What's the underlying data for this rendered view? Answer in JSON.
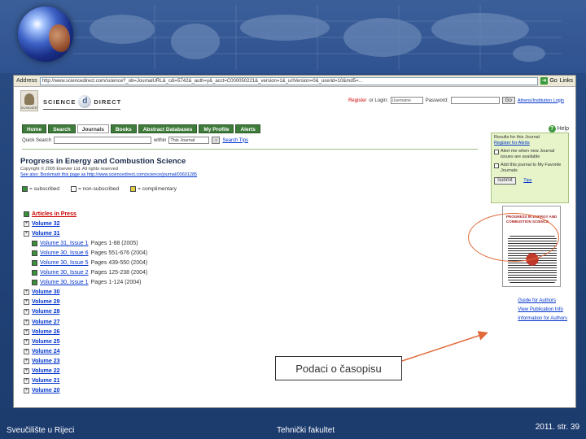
{
  "browser": {
    "address_label": "Address",
    "address_url": "http://www.sciencedirect.com/science?_ob=JournalURL&_cdi=5742&_auth=y&_acct=C000050221&_version=1&_urlVersion=0&_userid=10&md5=...",
    "go_label": "Go",
    "links_label": "Links"
  },
  "sd_header": {
    "elsevier_text": "ELSEVIER",
    "logo_left": "SCIENCE",
    "logo_mark": "d",
    "logo_right": "DIRECT",
    "register_label": "Register",
    "login_label": "or Login:",
    "username_value": "Username",
    "password_label": "Password:",
    "login_button": "Go",
    "login_links": "Athens/Institution Login"
  },
  "nav": {
    "tabs": [
      "Home",
      "Search",
      "Journals",
      "Books",
      "Abstract Databases",
      "My Profile",
      "Alerts"
    ],
    "help_label": "Help"
  },
  "quick_search": {
    "label": "Quick Search",
    "within_label": "within",
    "within_value": "This Journal",
    "search_tips": "Search Tips"
  },
  "journal": {
    "title": "Progress in Energy and Combustion Science",
    "meta_line1": "Copyright © 2005 Elsevier Ltd. All rights reserved",
    "meta_line2": "See also: Bookmark this page as http://www.sciencedirect.com/science/journal/03601285"
  },
  "legend": {
    "subscribed": "= subscribed",
    "non_subscribed": "= non-subscribed",
    "complimentary": "= complimentary"
  },
  "volumes": {
    "articles_in_press": "Articles in Press",
    "items": [
      {
        "type": "volume",
        "label": "Volume 32"
      },
      {
        "type": "volume",
        "label": "Volume 31"
      },
      {
        "type": "issue",
        "label": "Volume 31, Issue 1",
        "detail": "Pages 1-88 (2005)"
      },
      {
        "type": "issue",
        "label": "Volume 30, Issue 6",
        "detail": "Pages 551-676 (2004)"
      },
      {
        "type": "issue",
        "label": "Volume 30, Issue 5",
        "detail": "Pages 439-550 (2004)"
      },
      {
        "type": "issue",
        "label": "Volume 30, Issue 2",
        "detail": "Pages 125-238 (2004)"
      },
      {
        "type": "issue",
        "label": "Volume 30, Issue 1",
        "detail": "Pages 1-124 (2004)"
      },
      {
        "type": "volume",
        "label": "Volume 30"
      },
      {
        "type": "volume",
        "label": "Volume 29"
      },
      {
        "type": "volume",
        "label": "Volume 28"
      },
      {
        "type": "volume",
        "label": "Volume 27"
      },
      {
        "type": "volume",
        "label": "Volume 26"
      },
      {
        "type": "volume",
        "label": "Volume 25"
      },
      {
        "type": "volume",
        "label": "Volume 24"
      },
      {
        "type": "volume",
        "label": "Volume 23"
      },
      {
        "type": "volume",
        "label": "Volume 22"
      },
      {
        "type": "volume",
        "label": "Volume 21"
      },
      {
        "type": "volume",
        "label": "Volume 20"
      }
    ]
  },
  "right_panel": {
    "line1": "Results for this Journal",
    "line2": "Register for Alerts",
    "alert_check": "Alert me when new Journal issues are available",
    "add_check": "Add this journal to My Favorite Journals",
    "submit": "Submit",
    "tips": "Tips"
  },
  "cover": {
    "title": "PROGRESS IN ENERGY AND COMBUSTION SCIENCE"
  },
  "cover_links": {
    "guide": "Guide for Authors",
    "info": "View Publication Info",
    "order": "Information for Authors"
  },
  "callout": {
    "text": "Podaci o časopisu",
    "accent_color": "#e06a3a"
  },
  "footer": {
    "left": "Sveučilište u Rijeci",
    "center": "Tehnički fakultet",
    "right": "2011.  str. 39"
  }
}
